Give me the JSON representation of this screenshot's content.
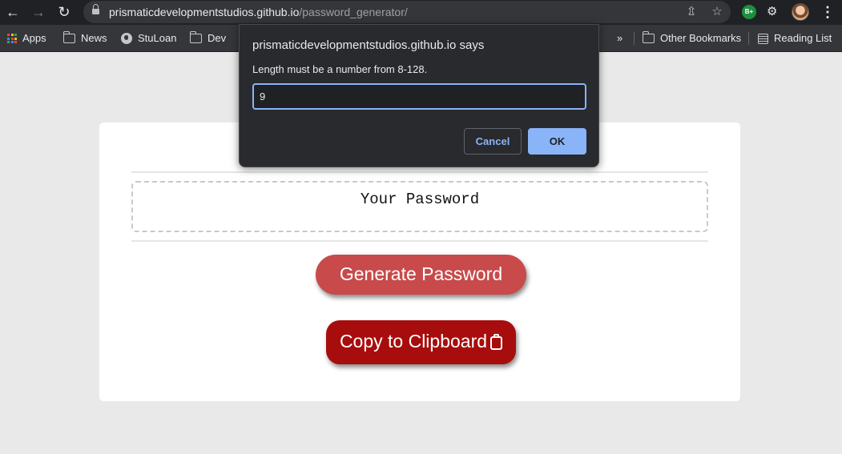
{
  "browser": {
    "url_host": "prismaticdevelopmentstudios.github.io",
    "url_path": "/password_generator/",
    "extension_badge": "B+",
    "bookmarks": [
      {
        "label": "Apps",
        "icon": "apps-grid-icon"
      },
      {
        "label": "News",
        "icon": "folder-icon"
      },
      {
        "label": "StuLoan",
        "icon": "globe-icon"
      },
      {
        "label": "Dev",
        "icon": "folder-icon"
      }
    ],
    "overflow_label": "»",
    "other_bookmarks": "Other Bookmarks",
    "reading_list": "Reading List"
  },
  "dialog": {
    "title": "prismaticdevelopmentstudios.github.io says",
    "message": "Length must be a number from 8-128.",
    "input_value": "9",
    "cancel_label": "Cancel",
    "ok_label": "OK"
  },
  "page": {
    "password_placeholder": "Your Password",
    "generate_label": "Generate Password",
    "copy_label": "Copy to Clipboard"
  },
  "colors": {
    "generate_button": "#c84a4a",
    "copy_button": "#a80d0d",
    "dialog_accent": "#8ab4f8"
  }
}
